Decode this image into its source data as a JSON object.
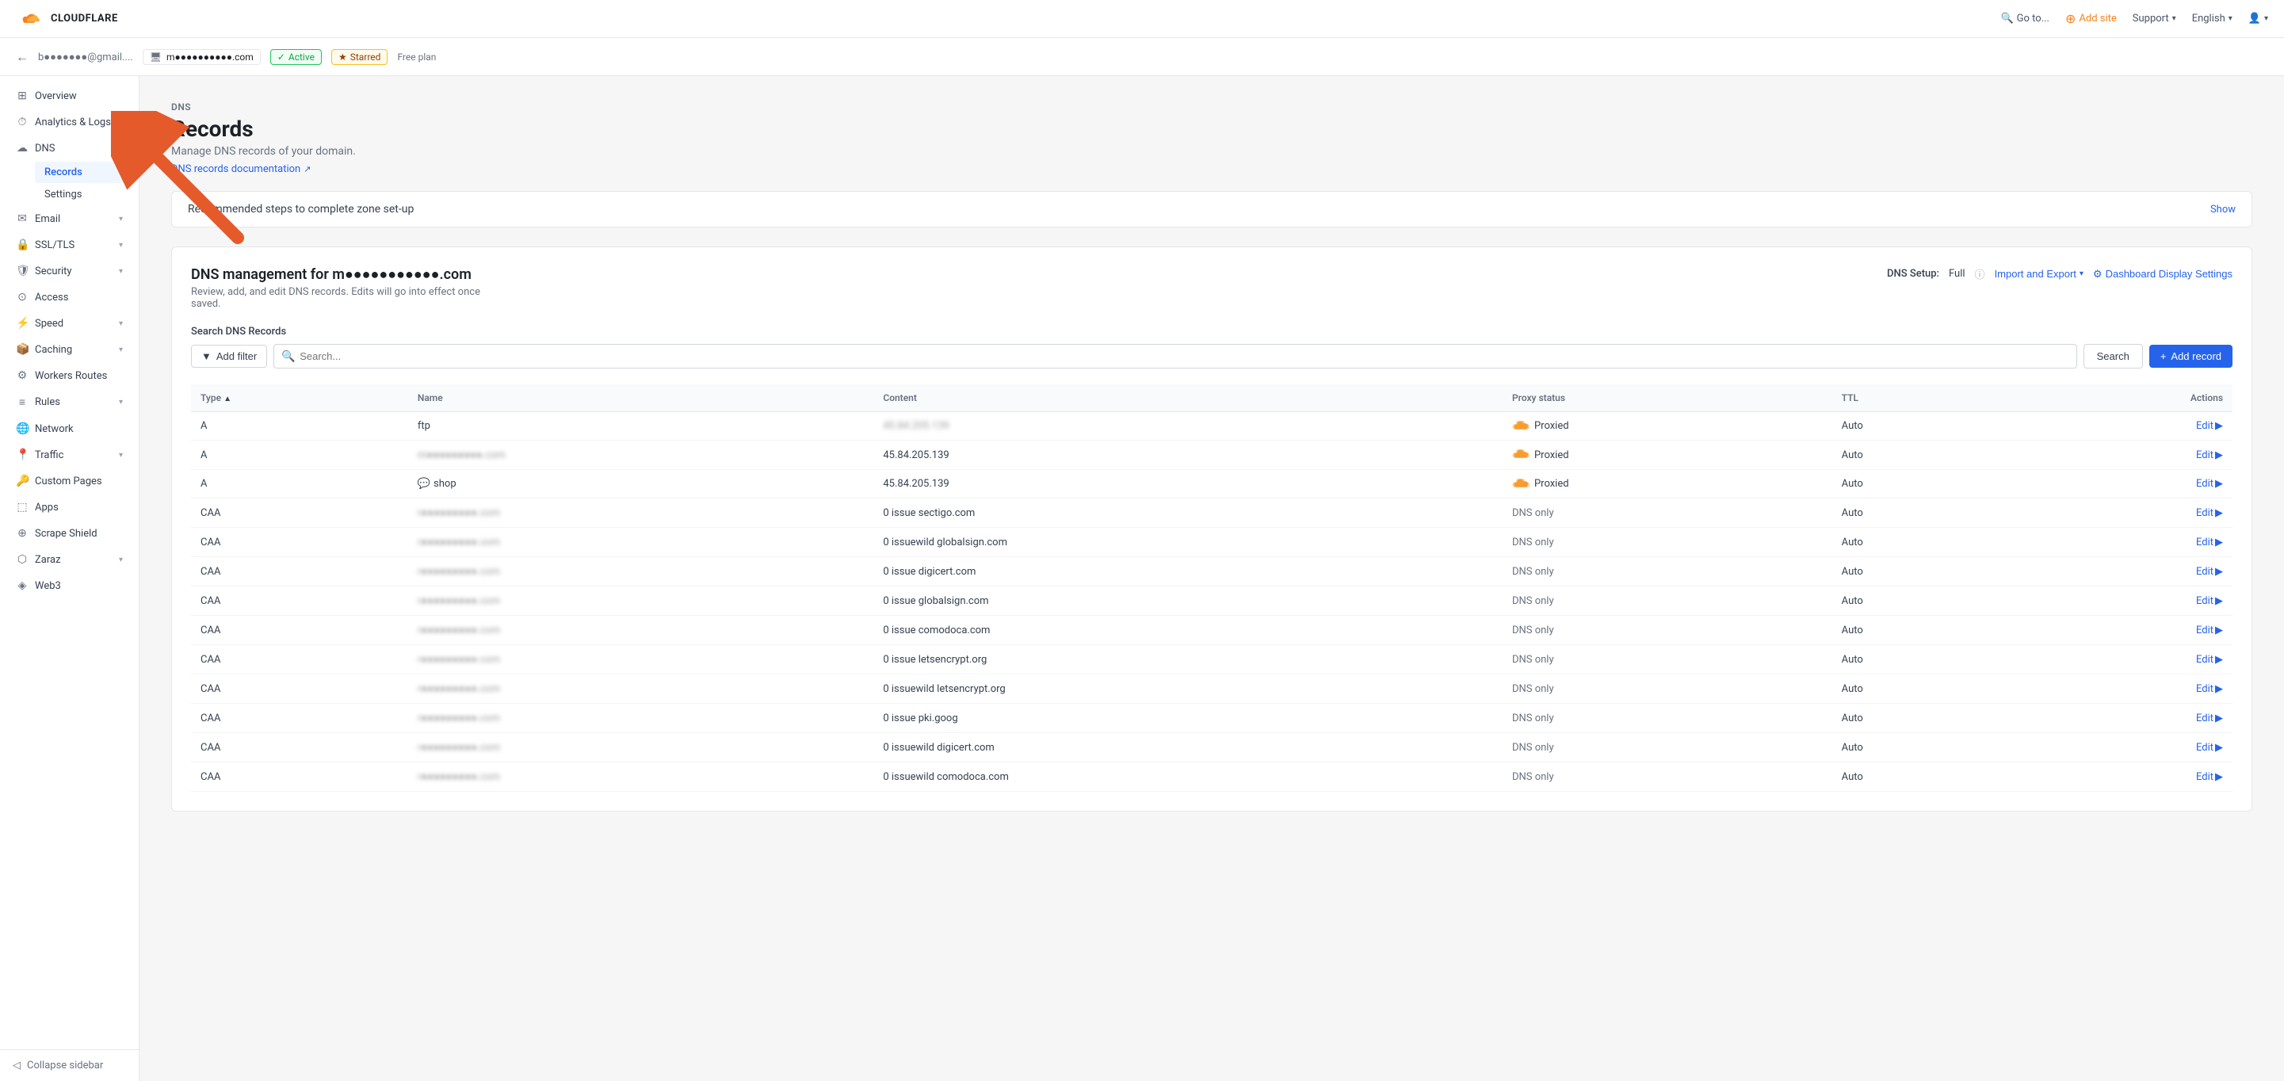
{
  "navbar": {
    "logo_text": "CLOUDFLARE",
    "goto_label": "Go to...",
    "add_site_label": "Add site",
    "support_label": "Support",
    "language_label": "English",
    "user_icon_label": "user"
  },
  "domain_bar": {
    "user_email": "b●●●●●●●@gmail....",
    "domain": "m●●●●●●●●●●.com",
    "active_label": "Active",
    "starred_label": "Starred",
    "plan_label": "Free plan",
    "back_label": "←"
  },
  "sidebar": {
    "overview_label": "Overview",
    "analytics_label": "Analytics & Logs",
    "dns_label": "DNS",
    "dns_records_label": "Records",
    "dns_settings_label": "Settings",
    "email_label": "Email",
    "ssltls_label": "SSL/TLS",
    "security_label": "Security",
    "access_label": "Access",
    "speed_label": "Speed",
    "caching_label": "Caching",
    "workers_routes_label": "Workers Routes",
    "rules_label": "Rules",
    "network_label": "Network",
    "traffic_label": "Traffic",
    "custom_pages_label": "Custom Pages",
    "apps_label": "Apps",
    "scrape_shield_label": "Scrape Shield",
    "zaraz_label": "Zaraz",
    "web3_label": "Web3",
    "collapse_label": "Collapse sidebar"
  },
  "page": {
    "section_label": "DNS",
    "title": "Records",
    "description": "Manage DNS records of your domain.",
    "docs_link": "DNS records documentation",
    "rec_banner_text": "Recommended steps to complete zone set-up",
    "show_label": "Show",
    "dns_management_title": "DNS management for m●●●●●●●●●●●.com",
    "dns_management_desc": "Review, add, and edit DNS records. Edits will go into effect once saved.",
    "dns_setup_label": "DNS Setup:",
    "dns_setup_value": "Full",
    "import_export_label": "Import and Export",
    "dashboard_display_label": "Dashboard Display Settings",
    "search_dns_label": "Search DNS Records",
    "add_filter_label": "Add filter",
    "search_placeholder": "Search...",
    "search_button_label": "Search",
    "add_record_label": "Add record"
  },
  "table": {
    "col_type": "Type",
    "col_name": "Name",
    "col_content": "Content",
    "col_proxy": "Proxy status",
    "col_ttl": "TTL",
    "col_actions": "Actions",
    "rows": [
      {
        "type": "A",
        "name": "ftp",
        "content": "45.84.205.139",
        "proxy": "Proxied",
        "proxy_type": "proxied",
        "ttl": "Auto",
        "action": "Edit"
      },
      {
        "type": "A",
        "name": "m●●●●●●●●●.com",
        "content": "45.84.205.139",
        "proxy": "Proxied",
        "proxy_type": "proxied",
        "ttl": "Auto",
        "action": "Edit"
      },
      {
        "type": "A",
        "name": "shop",
        "content": "45.84.205.139",
        "proxy": "Proxied",
        "proxy_type": "proxied",
        "ttl": "Auto",
        "action": "Edit"
      },
      {
        "type": "CAA",
        "name": "r●●●●●●●●●.com",
        "content": "0 issue sectigo.com",
        "proxy": "DNS only",
        "proxy_type": "dns",
        "ttl": "Auto",
        "action": "Edit"
      },
      {
        "type": "CAA",
        "name": "r●●●●●●●●●.com",
        "content": "0 issuewild globalsign.com",
        "proxy": "DNS only",
        "proxy_type": "dns",
        "ttl": "Auto",
        "action": "Edit"
      },
      {
        "type": "CAA",
        "name": "r●●●●●●●●●.com",
        "content": "0 issue digicert.com",
        "proxy": "DNS only",
        "proxy_type": "dns",
        "ttl": "Auto",
        "action": "Edit"
      },
      {
        "type": "CAA",
        "name": "r●●●●●●●●●.com",
        "content": "0 issue globalsign.com",
        "proxy": "DNS only",
        "proxy_type": "dns",
        "ttl": "Auto",
        "action": "Edit"
      },
      {
        "type": "CAA",
        "name": "r●●●●●●●●●.com",
        "content": "0 issue comodoca.com",
        "proxy": "DNS only",
        "proxy_type": "dns",
        "ttl": "Auto",
        "action": "Edit"
      },
      {
        "type": "CAA",
        "name": "r●●●●●●●●●.com",
        "content": "0 issue letsencrypt.org",
        "proxy": "DNS only",
        "proxy_type": "dns",
        "ttl": "Auto",
        "action": "Edit"
      },
      {
        "type": "CAA",
        "name": "r●●●●●●●●●.com",
        "content": "0 issuewild letsencrypt.org",
        "proxy": "DNS only",
        "proxy_type": "dns",
        "ttl": "Auto",
        "action": "Edit"
      },
      {
        "type": "CAA",
        "name": "r●●●●●●●●●.com",
        "content": "0 issue pki.goog",
        "proxy": "DNS only",
        "proxy_type": "dns",
        "ttl": "Auto",
        "action": "Edit"
      },
      {
        "type": "CAA",
        "name": "r●●●●●●●●●.com",
        "content": "0 issuewild digicert.com",
        "proxy": "DNS only",
        "proxy_type": "dns",
        "ttl": "Auto",
        "action": "Edit"
      },
      {
        "type": "CAA",
        "name": "r●●●●●●●●●.com",
        "content": "0 issuewild comodoca.com",
        "proxy": "DNS only",
        "proxy_type": "dns",
        "ttl": "Auto",
        "action": "Edit"
      }
    ]
  },
  "colors": {
    "accent_blue": "#2563eb",
    "cloudflare_orange": "#f6821f",
    "active_green": "#16a34a",
    "starred_yellow": "#fbbf24"
  }
}
